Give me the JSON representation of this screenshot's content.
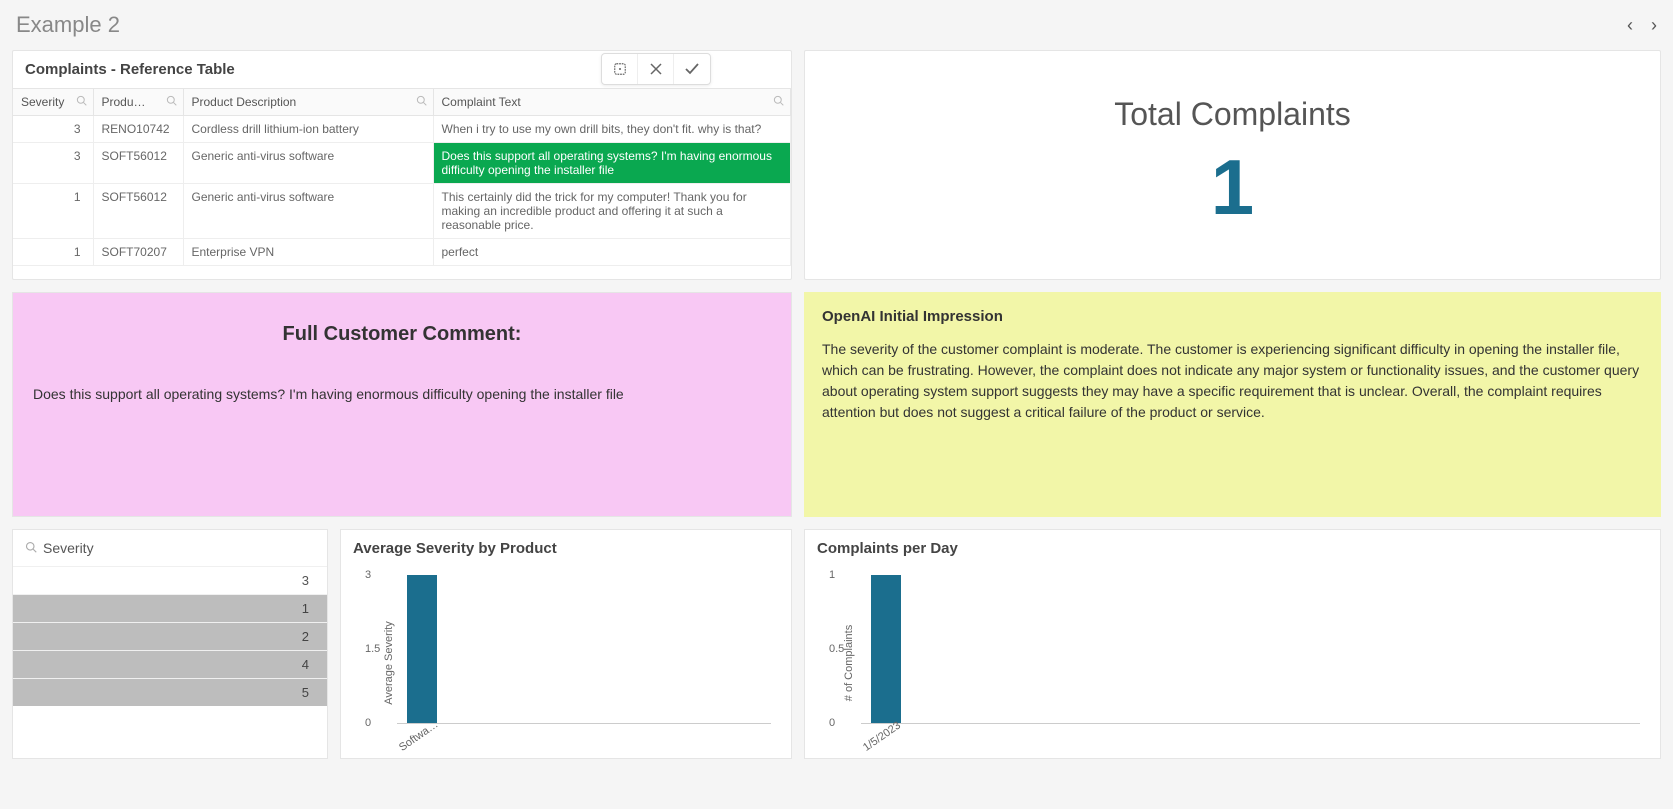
{
  "page": {
    "title": "Example 2"
  },
  "table": {
    "title": "Complaints - Reference Table",
    "columns": [
      "Severity",
      "Produ…",
      "Product Description",
      "Complaint Text"
    ],
    "rows": [
      {
        "severity": "3",
        "product": "RENO10742",
        "description": "Cordless drill lithium-ion battery",
        "text": "When i try to use my own drill bits, they don't fit. why is that?",
        "selected": false
      },
      {
        "severity": "3",
        "product": "SOFT56012",
        "description": "Generic anti-virus software",
        "text": "Does this support all operating systems? I'm having enormous difficulty opening the installer file",
        "selected": true
      },
      {
        "severity": "1",
        "product": "SOFT56012",
        "description": "Generic anti-virus software",
        "text": "This certainly did the trick for my computer! Thank you for making an incredible product and offering it at such a reasonable price.",
        "selected": false
      },
      {
        "severity": "1",
        "product": "SOFT70207",
        "description": "Enterprise VPN",
        "text": "perfect",
        "selected": false
      }
    ]
  },
  "kpi": {
    "title": "Total Complaints",
    "value": "1"
  },
  "comment": {
    "title": "Full Customer Comment:",
    "body": "Does this support all operating systems? I'm having enormous difficulty opening the installer file"
  },
  "impression": {
    "title": "OpenAI Initial Impression",
    "body": "The severity of the customer complaint is moderate. The customer is experiencing significant difficulty in opening the installer file, which can be frustrating. However, the complaint does not indicate any major system or functionality issues, and the customer query about operating system support suggests they may have a specific requirement that is unclear. Overall, the complaint requires attention but does not suggest a critical failure of the product or service."
  },
  "filter": {
    "label": "Severity",
    "items": [
      {
        "value": "3",
        "dim": false
      },
      {
        "value": "1",
        "dim": true
      },
      {
        "value": "2",
        "dim": true
      },
      {
        "value": "4",
        "dim": true
      },
      {
        "value": "5",
        "dim": true
      }
    ]
  },
  "chart_avg": {
    "title": "Average Severity by Product",
    "ylabel": "Average Severity"
  },
  "chart_day": {
    "title": "Complaints per Day",
    "ylabel": "# of Complaints"
  },
  "chart_data": [
    {
      "type": "bar",
      "title": "Average Severity by Product",
      "ylabel": "Average Severity",
      "ylim": [
        0,
        3
      ],
      "yticks": [
        0,
        1.5,
        3
      ],
      "categories": [
        "Softwa…"
      ],
      "values": [
        3
      ]
    },
    {
      "type": "bar",
      "title": "Complaints per Day",
      "ylabel": "# of Complaints",
      "ylim": [
        0,
        1
      ],
      "yticks": [
        0,
        0.5,
        1
      ],
      "categories": [
        "1/5/2023"
      ],
      "values": [
        1
      ]
    }
  ]
}
